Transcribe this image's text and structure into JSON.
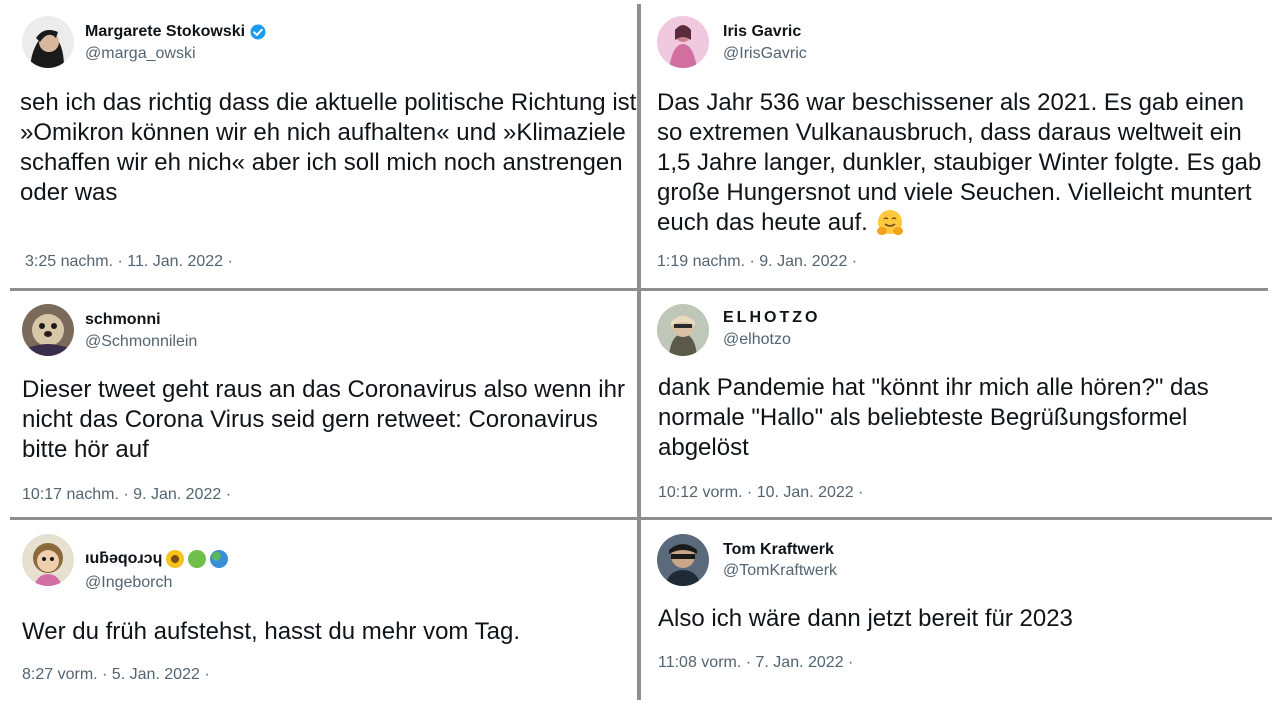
{
  "tweets": [
    {
      "name": "Margarete Stokowski",
      "handle": "@marga_owski",
      "text": "seh ich das richtig dass die aktuelle politische Richtung ist »Omikron können wir eh nich aufhalten« und »Klimaziele schaffen wir eh nich« aber ich soll mich noch anstrengen oder was",
      "meta": "3:25 nachm. · 11. Jan. 2022 ·",
      "verified": true
    },
    {
      "name": "Iris Gavric",
      "handle": "@IrisGavric",
      "text": "Das Jahr 536 war beschissener als 2021. Es gab einen so extremen Vulkanausbruch, dass daraus weltweit ein 1,5 Jahre langer, dunkler, staubiger Winter folgte. Es gab große Hungersnot und viele Seuchen. Vielleicht muntert euch das heute auf.",
      "text_emoji": "hugging-face-emoji",
      "meta": "1:19 nachm. · 9. Jan. 2022 ·"
    },
    {
      "name": "schmonni",
      "handle": "@Schmonnilein",
      "text": "Dieser tweet geht raus an das Coronavirus also wenn ihr nicht das Corona Virus seid gern retweet: Coronavirus bitte hör auf",
      "meta": "10:17 nachm. · 9. Jan. 2022 ·"
    },
    {
      "name": "ELHOTZO",
      "handle": "@elhotzo",
      "text": "dank Pandemie hat \"könnt ihr mich alle hören?\" das normale \"Hallo\" als beliebteste Begrüßungsformel abgelöst",
      "meta": "10:12 vorm. · 10. Jan. 2022 ·"
    },
    {
      "name": "ıuƃǝqoɹɔɥ",
      "name_emojis": [
        "sunflower-emoji",
        "green-heart-emoji",
        "globe-emoji"
      ],
      "handle": "@Ingeborch",
      "text": "Wer du früh aufstehst, hasst du mehr vom Tag.",
      "meta": "8:27 vorm. · 5. Jan. 2022 ·"
    },
    {
      "name": "Tom Kraftwerk",
      "handle": "@TomKraftwerk",
      "text": "Also ich wäre dann jetzt bereit für 2023",
      "meta": "11:08 vorm. · 7. Jan. 2022 ·"
    }
  ],
  "colors": {
    "text": "#0f1419",
    "secondary": "#536471",
    "divider": "#8e8e8e",
    "verified": "#1d9bf0"
  }
}
